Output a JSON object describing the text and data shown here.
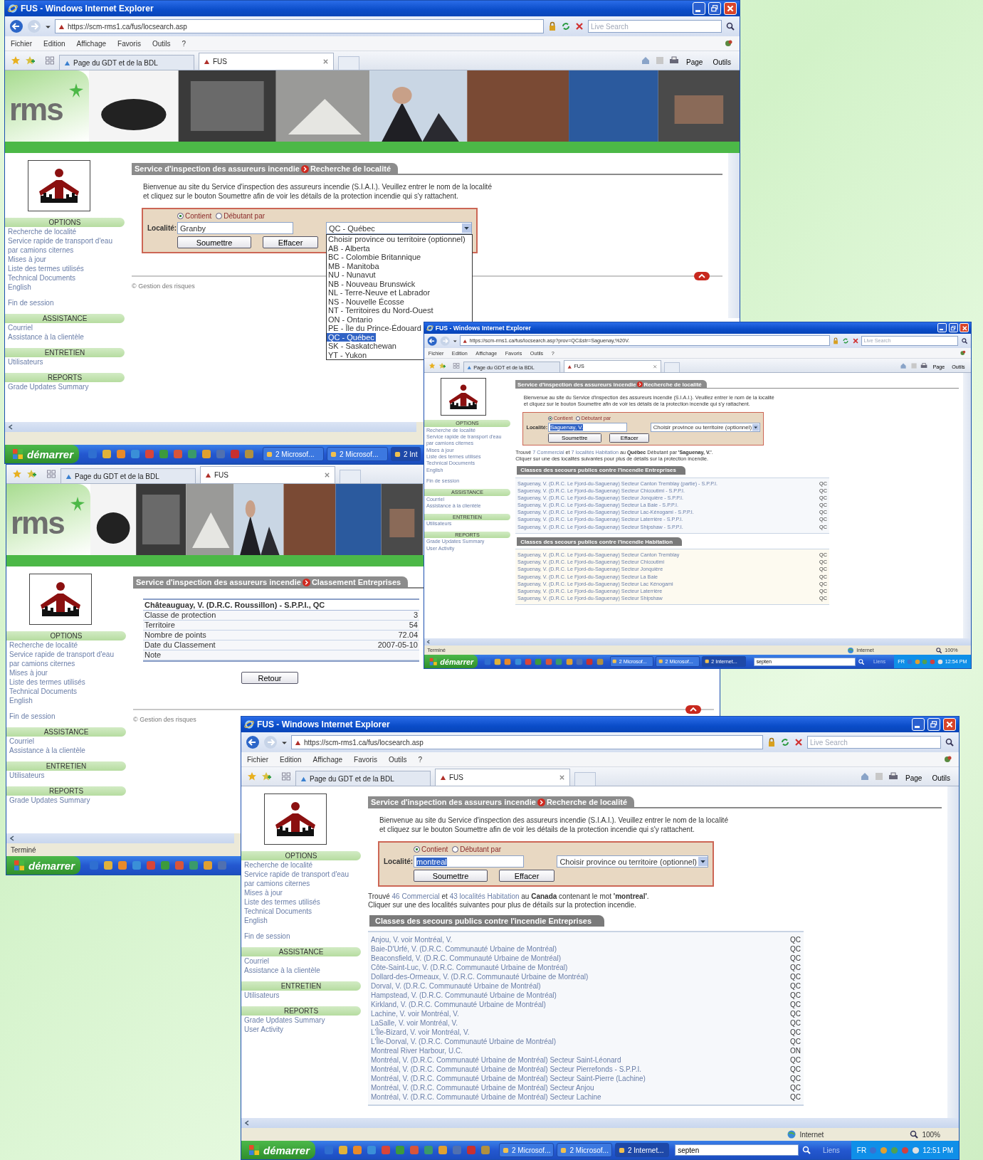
{
  "windows": [
    {
      "title": "FUS - Windows Internet Explorer",
      "address": "https://scm-rms1.ca/fus/locsearch.asp",
      "search_placeholder": "Live Search",
      "menu": [
        "Fichier",
        "Edition",
        "Affichage",
        "Favoris",
        "Outils",
        "?"
      ],
      "tabs": [
        {
          "label": "Page du GDT et de la BDL",
          "selected": false
        },
        {
          "label": "FUS",
          "selected": true
        }
      ],
      "toolbar": [
        "Page",
        "Outils"
      ],
      "banner": {
        "logo": "rms"
      },
      "sidebar": [
        {
          "heading": "OPTIONS",
          "links": [
            "Recherche de localité",
            "Service rapide de transport d'eau par camions citernes",
            "Mises à jour",
            "Liste des termes utilisés",
            "Technical Documents",
            "English"
          ]
        },
        {
          "links": [
            "Fin de session"
          ]
        },
        {
          "heading": "ASSISTANCE",
          "links": [
            "Courriel",
            "Assistance à la clientèle"
          ]
        },
        {
          "heading": "ENTRETIEN",
          "links": [
            "Utilisateurs"
          ]
        },
        {
          "heading": "REPORTS",
          "links": [
            "Grade Updates Summary"
          ]
        }
      ],
      "heading": {
        "site": "Service d'inspection des assureurs incendie",
        "page": "Recherche de localité"
      },
      "intro": "Bienvenue au site du Service d'inspection des assureurs incendie (S.I.A.I.). Veuillez entrer le nom de la localité et cliquez sur le bouton Soumettre afin de voir les détails de la protection incendie qui s'y rattachent.",
      "form": {
        "options": [
          {
            "label": "Contient",
            "selected": true
          },
          {
            "label": "Débutant par",
            "selected": false
          }
        ],
        "label": "Localité:",
        "value": "Granby",
        "text_selected": false,
        "province": "QC - Québec",
        "buttons": [
          "Soumettre",
          "Effacer"
        ],
        "dropdown": [
          {
            "label": "Choisir province ou territoire (optionnel)",
            "selected": false
          },
          {
            "label": "AB - Alberta",
            "selected": false
          },
          {
            "label": "BC - Colombie Britannique",
            "selected": false
          },
          {
            "label": "MB - Manitoba",
            "selected": false
          },
          {
            "label": "NU - Nunavut",
            "selected": false
          },
          {
            "label": "NB - Nouveau Brunswick",
            "selected": false
          },
          {
            "label": "NL - Terre-Neuve et Labrador",
            "selected": false
          },
          {
            "label": "NS - Nouvelle Écosse",
            "selected": false
          },
          {
            "label": "NT - Territoires du Nord-Ouest",
            "selected": false
          },
          {
            "label": "ON - Ontario",
            "selected": false
          },
          {
            "label": "PE - Île du Prince-Édouard",
            "selected": false
          },
          {
            "label": "QC - Québec",
            "selected": true
          },
          {
            "label": "SK - Saskatchewan",
            "selected": false
          },
          {
            "label": "YT - Yukon",
            "selected": false
          }
        ]
      },
      "footer": "© Gestion des risques",
      "taskbar": {
        "start": "démarrer",
        "buttons": [
          "2 Microsof...",
          "2 Microsof...",
          "2 Int"
        ]
      }
    },
    {
      "title": "FUS - Windows Internet Explorer",
      "address": "https://scm-rms1.ca/fus/locsearch.asp?prov=QC&str=Saguenay,%20V.",
      "search_placeholder": "Live Search",
      "menu": [
        "Fichier",
        "Edition",
        "Affichage",
        "Favoris",
        "Outils",
        "?"
      ],
      "tabs": [
        {
          "label": "Page du GDT et de la BDL",
          "selected": false
        },
        {
          "label": "FUS",
          "selected": true
        }
      ],
      "toolbar": [
        "Page",
        "Outils"
      ],
      "sidebar": [
        {
          "heading": "OPTIONS",
          "links": [
            "Recherche de localité",
            "Service rapide de transport d'eau par camions citernes",
            "Mises à jour",
            "Liste des termes utilisés",
            "Technical Documents",
            "English"
          ]
        },
        {
          "links": [
            "Fin de session"
          ]
        },
        {
          "heading": "ASSISTANCE",
          "links": [
            "Courriel",
            "Assistance à la clientèle"
          ]
        },
        {
          "heading": "ENTRETIEN",
          "links": [
            "Utilisateurs"
          ]
        },
        {
          "heading": "REPORTS",
          "links": [
            "Grade Updates Summary",
            "User Activity"
          ]
        }
      ],
      "heading": {
        "site": "Service d'inspection des assureurs incendie",
        "page": "Recherche de localité"
      },
      "intro": "Bienvenue au site du Service d'inspection des assureurs incendie (S.I.A.I.). Veuillez entrer le nom de la localité et cliquez sur le bouton Soumettre afin de voir les détails de la protection incendie qui s'y rattachent.",
      "form": {
        "options": [
          {
            "label": "Contient",
            "selected": true
          },
          {
            "label": "Débutant par",
            "selected": false
          }
        ],
        "label": "Localité:",
        "value": "Saguenay, V.",
        "text_selected": true,
        "province": "Choisir province ou territoire (optionnel)",
        "buttons": [
          "Soumettre",
          "Effacer"
        ]
      },
      "result": {
        "parts": [
          {
            "kind": "text",
            "text": "Trouvé "
          },
          {
            "kind": "link",
            "text": "7 Commercial"
          },
          {
            "kind": "text",
            "text": " et "
          },
          {
            "kind": "link",
            "text": "7 localités Habitation"
          },
          {
            "kind": "text",
            "text": " au **Québec** Débutant par **'Saguenay, V.'**."
          }
        ],
        "hint": "Cliquer sur une des localités suivantes pour plus de détails sur la protection incendie."
      },
      "tables": [
        {
          "title": "Classes des secours publics contre l'incendie Entreprises",
          "rows": [
            {
              "name": "Saguenay, V. (D.R.C. Le Fjord-du-Saguenay) Secteur Canton Tremblay (partie) - S.P.P.I.",
              "province": "QC"
            },
            {
              "name": "Saguenay, V. (D.R.C. Le Fjord-du-Saguenay) Secteur Chicoutimi - S.P.P.I.",
              "province": "QC"
            },
            {
              "name": "Saguenay, V. (D.R.C. Le Fjord-du-Saguenay) Secteur Jonquière - S.P.P.I.",
              "province": "QC"
            },
            {
              "name": "Saguenay, V. (D.R.C. Le Fjord-du-Saguenay) Secteur La Baie - S.P.P.I.",
              "province": "QC"
            },
            {
              "name": "Saguenay, V. (D.R.C. Le Fjord-du-Saguenay) Secteur Lac-Kénogami - S.P.P.I.",
              "province": "QC"
            },
            {
              "name": "Saguenay, V. (D.R.C. Le Fjord-du-Saguenay) Secteur Laterrière - S.P.P.I.",
              "province": "QC"
            },
            {
              "name": "Saguenay, V. (D.R.C. Le Fjord-du-Saguenay) Secteur Shipshaw - S.P.P.I.",
              "province": "QC"
            }
          ]
        },
        {
          "title": "Classes des secours publics contre l'incendie Habitation",
          "rows": [
            {
              "name": "Saguenay, V. (D.R.C. Le Fjord-du-Saguenay) Secteur Canton Tremblay",
              "province": "QC"
            },
            {
              "name": "Saguenay, V. (D.R.C. Le Fjord-du-Saguenay) Secteur Chicoutimi",
              "province": "QC"
            },
            {
              "name": "Saguenay, V. (D.R.C. Le Fjord-du-Saguenay) Secteur Jonquière",
              "province": "QC"
            },
            {
              "name": "Saguenay, V. (D.R.C. Le Fjord-du-Saguenay) Secteur La Baie",
              "province": "QC"
            },
            {
              "name": "Saguenay, V. (D.R.C. Le Fjord-du-Saguenay) Secteur Lac Kénogami",
              "province": "QC"
            },
            {
              "name": "Saguenay, V. (D.R.C. Le Fjord-du-Saguenay) Secteur Laterrière",
              "province": "QC"
            },
            {
              "name": "Saguenay, V. (D.R.C. Le Fjord-du-Saguenay) Secteur Shipshaw",
              "province": "QC"
            }
          ]
        }
      ],
      "status": {
        "text": "Terminé",
        "zone": "Internet",
        "zoom": "100%"
      },
      "taskbar": {
        "start": "démarrer",
        "buttons": [
          "2 Microsof...",
          "2 Microsof...",
          "2 Internet..."
        ],
        "search": "septen",
        "links": "Liens",
        "lang": "FR",
        "clock": "12:54 PM"
      }
    },
    {
      "tabs": [
        {
          "label": "Page du GDT et de la BDL",
          "selected": false
        },
        {
          "label": "FUS",
          "selected": true
        }
      ],
      "banner": {
        "logo": "rms"
      },
      "sidebar": [
        {
          "heading": "OPTIONS",
          "links": [
            "Recherche de localité",
            "Service rapide de transport d'eau par camions citernes",
            "Mises à jour",
            "Liste des termes utilisés",
            "Technical Documents",
            "English"
          ]
        },
        {
          "links": [
            "Fin de session"
          ]
        },
        {
          "heading": "ASSISTANCE",
          "links": [
            "Courriel",
            "Assistance à la clientèle"
          ]
        },
        {
          "heading": "ENTRETIEN",
          "links": [
            "Utilisateurs"
          ]
        },
        {
          "heading": "REPORTS",
          "links": [
            "Grade Updates Summary"
          ]
        }
      ],
      "heading": {
        "site": "Service d'inspection des assureurs incendie",
        "page": "Classement Entreprises"
      },
      "detail": {
        "caption": "Châteauguay, V. (D.R.C. Roussillon) - S.P.P.I., QC",
        "rows": [
          {
            "label": "Classe de protection",
            "value": "3"
          },
          {
            "label": "Territoire",
            "value": "54"
          },
          {
            "label": "Nombre de points",
            "value": "72.04"
          },
          {
            "label": "Date du Classement",
            "value": "2007-05-10"
          },
          {
            "label": "Note"
          }
        ],
        "back": "Retour"
      },
      "footer": "© Gestion des risques",
      "status": {
        "text": "Terminé"
      },
      "taskbar": {
        "start": "démarrer"
      }
    },
    {
      "title": "FUS - Windows Internet Explorer",
      "address": "https://scm-rms1.ca/fus/locsearch.asp",
      "search_placeholder": "Live Search",
      "menu": [
        "Fichier",
        "Edition",
        "Affichage",
        "Favoris",
        "Outils",
        "?"
      ],
      "tabs": [
        {
          "label": "Page du GDT et de la BDL",
          "selected": false
        },
        {
          "label": "FUS",
          "selected": true
        }
      ],
      "toolbar": [
        "Page",
        "Outils"
      ],
      "sidebar": [
        {
          "heading": "OPTIONS",
          "links": [
            "Recherche de localité",
            "Service rapide de transport d'eau par camions citernes",
            "Mises à jour",
            "Liste des termes utilisés",
            "Technical Documents",
            "English"
          ]
        },
        {
          "links": [
            "Fin de session"
          ]
        },
        {
          "heading": "ASSISTANCE",
          "links": [
            "Courriel",
            "Assistance à la clientèle"
          ]
        },
        {
          "heading": "ENTRETIEN",
          "links": [
            "Utilisateurs"
          ]
        },
        {
          "heading": "REPORTS",
          "links": [
            "Grade Updates Summary",
            "User Activity"
          ]
        }
      ],
      "heading": {
        "site": "Service d'inspection des assureurs incendie",
        "page": "Recherche de localité"
      },
      "intro": "Bienvenue au site du Service d'inspection des assureurs incendie (S.I.A.I.). Veuillez entrer le nom de la localité et cliquez sur le bouton Soumettre afin de voir les détails de la protection incendie qui s'y rattachent.",
      "form": {
        "options": [
          {
            "label": "Contient",
            "selected": true
          },
          {
            "label": "Débutant par",
            "selected": false
          }
        ],
        "label": "Localité:",
        "value": "montreal",
        "text_selected": true,
        "province": "Choisir province ou territoire (optionnel)",
        "buttons": [
          "Soumettre",
          "Effacer"
        ]
      },
      "result": {
        "parts": [
          {
            "kind": "text",
            "text": "Trouvé "
          },
          {
            "kind": "link",
            "text": "46 Commercial"
          },
          {
            "kind": "text",
            "text": " et "
          },
          {
            "kind": "link",
            "text": "43 localités Habitation"
          },
          {
            "kind": "text",
            "text": " au **Canada** contenant le mot **'montreal'**."
          }
        ],
        "hint": "Cliquer sur une des localités suivantes pour plus de détails sur la protection incendie."
      },
      "tables": [
        {
          "title": "Classes des secours publics contre l'incendie Entreprises",
          "rows": [
            {
              "name": "Anjou, V. voir Montréal, V.",
              "province": "QC"
            },
            {
              "name": "Baie-D'Urfé, V. (D.R.C. Communauté Urbaine de Montréal)",
              "province": "QC"
            },
            {
              "name": "Beaconsfield, V. (D.R.C. Communauté Urbaine de Montréal)",
              "province": "QC"
            },
            {
              "name": "Côte-Saint-Luc, V. (D.R.C. Communauté Urbaine de Montréal)",
              "province": "QC"
            },
            {
              "name": "Dollard-des-Ormeaux, V. (D.R.C. Communauté Urbaine de Montréal)",
              "province": "QC"
            },
            {
              "name": "Dorval, V. (D.R.C. Communauté Urbaine de Montréal)",
              "province": "QC"
            },
            {
              "name": "Hampstead, V. (D.R.C. Communauté Urbaine de Montréal)",
              "province": "QC"
            },
            {
              "name": "Kirkland, V. (D.R.C. Communauté Urbaine de Montréal)",
              "province": "QC"
            },
            {
              "name": "Lachine, V. voir Montréal, V.",
              "province": "QC"
            },
            {
              "name": "LaSalle, V. voir Montréal, V.",
              "province": "QC"
            },
            {
              "name": "L'Île-Bizard, V. voir Montréal, V.",
              "province": "QC"
            },
            {
              "name": "L'Île-Dorval, V. (D.R.C. Communauté Urbaine de Montréal)",
              "province": "QC"
            },
            {
              "name": "Montreal River Harbour, U.C.",
              "province": "ON"
            },
            {
              "name": "Montréal, V. (D.R.C. Communauté Urbaine de Montréal) Secteur Saint-Léonard",
              "province": "QC"
            },
            {
              "name": "Montréal, V. (D.R.C. Communauté Urbaine de Montréal) Secteur Pierrefonds - S.P.P.I.",
              "province": "QC"
            },
            {
              "name": "Montréal, V. (D.R.C. Communauté Urbaine de Montréal) Secteur Saint-Pierre (Lachine)",
              "province": "QC"
            },
            {
              "name": "Montréal, V. (D.R.C. Communauté Urbaine de Montréal) Secteur Anjou",
              "province": "QC"
            },
            {
              "name": "Montréal, V. (D.R.C. Communauté Urbaine de Montréal) Secteur Lachine",
              "province": "QC"
            }
          ]
        }
      ],
      "status": {
        "zone": "Internet",
        "zoom": "100%"
      },
      "taskbar": {
        "start": "démarrer",
        "buttons": [
          "2 Microsof...",
          "2 Microsof...",
          "2 Internet..."
        ],
        "search": "septen",
        "links": "Liens",
        "lang": "FR",
        "clock": "12:51 PM"
      }
    }
  ]
}
